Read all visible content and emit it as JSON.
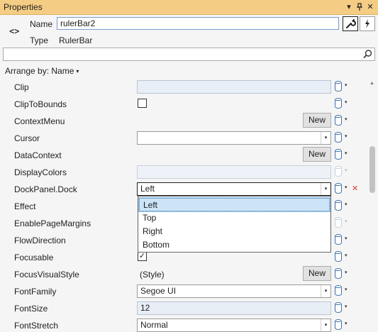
{
  "window": {
    "title": "Properties",
    "menu_icon": "▾",
    "pin_icon": "⊥",
    "close_icon": "✕"
  },
  "header": {
    "name_label": "Name",
    "name_value": "rulerBar2",
    "type_label": "Type",
    "type_value": "RulerBar",
    "element_icon": "<>",
    "properties_view_icon": "wrench-icon",
    "events_view_icon": "lightning-icon"
  },
  "search": {
    "placeholder": "",
    "icon": "search-icon"
  },
  "arrange": {
    "label": "Arrange by: Name",
    "chevron": "▾"
  },
  "new_label": "New",
  "dropdown_arrow": "▾",
  "marker_chevron": "▾",
  "reset_mark": "✕",
  "checkmark": "✓",
  "properties": [
    {
      "name": "Clip"
    },
    {
      "name": "ClipToBounds",
      "checked": false
    },
    {
      "name": "ContextMenu"
    },
    {
      "name": "Cursor",
      "value": ""
    },
    {
      "name": "DataContext"
    },
    {
      "name": "DisplayColors"
    },
    {
      "name": "DockPanel.Dock",
      "value": "Left"
    },
    {
      "name": "Effect"
    },
    {
      "name": "EnablePageMargins"
    },
    {
      "name": "FlowDirection"
    },
    {
      "name": "Focusable",
      "checked": true
    },
    {
      "name": "FocusVisualStyle",
      "value": "(Style)"
    },
    {
      "name": "FontFamily",
      "value": "Segoe UI"
    },
    {
      "name": "FontSize",
      "value": "12"
    },
    {
      "name": "FontStretch",
      "value": "Normal"
    }
  ],
  "dock_options": [
    "Left",
    "Top",
    "Right",
    "Bottom"
  ],
  "dock_selected": "Left",
  "colors": {
    "titlebar": "#f5cc84",
    "marker": "#3e6ea8",
    "selection": "#cce4f7",
    "reset": "#d83a3a"
  }
}
